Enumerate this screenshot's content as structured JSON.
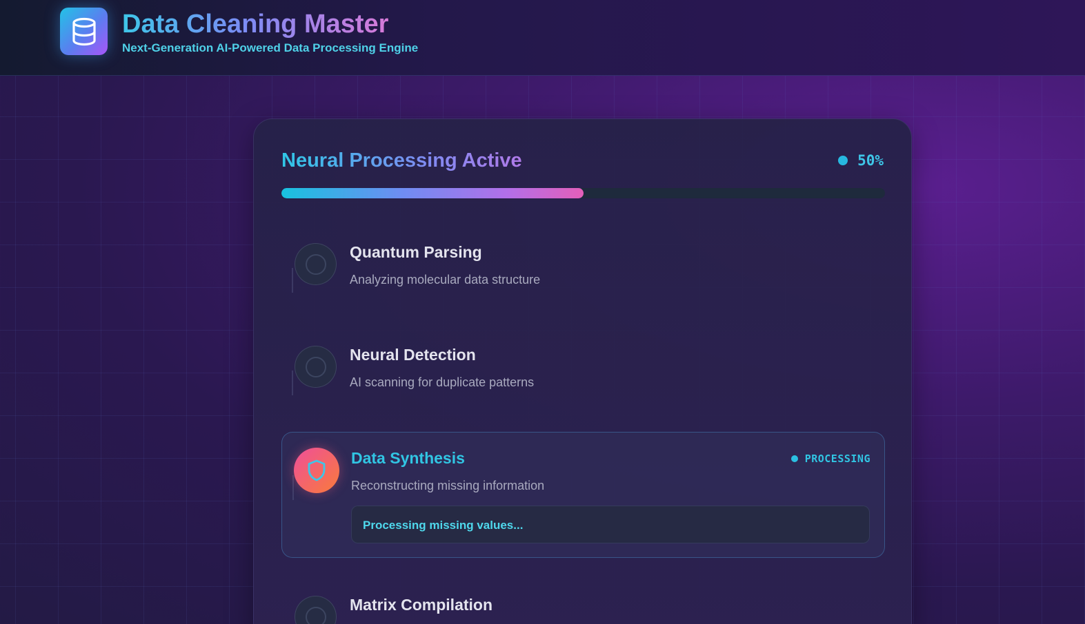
{
  "app": {
    "title": "Data Cleaning Master",
    "subtitle": "Next-Generation AI-Powered Data Processing Engine",
    "logo_icon": "database-icon"
  },
  "progress": {
    "title": "Neural Processing Active",
    "percent_label": "50%",
    "value": 0.5
  },
  "steps": [
    {
      "title": "Quantum Parsing",
      "description": "Analyzing molecular data structure",
      "state": "pending",
      "icon": "circle-icon"
    },
    {
      "title": "Neural Detection",
      "description": "AI scanning for duplicate patterns",
      "state": "pending",
      "icon": "circle-icon"
    },
    {
      "title": "Data Synthesis",
      "description": "Reconstructing missing information",
      "state": "processing",
      "status_label": "PROCESSING",
      "detail": "Processing missing values...",
      "icon": "shield-icon"
    },
    {
      "title": "Matrix Compilation",
      "state": "pending",
      "icon": "circle-icon"
    }
  ],
  "colors": {
    "accent_cyan": "#31c5e3",
    "accent_purple": "#a855f7",
    "accent_pink": "#e35fb9",
    "active_icon_orange": "#f97b3a",
    "background": "#2a1850"
  }
}
